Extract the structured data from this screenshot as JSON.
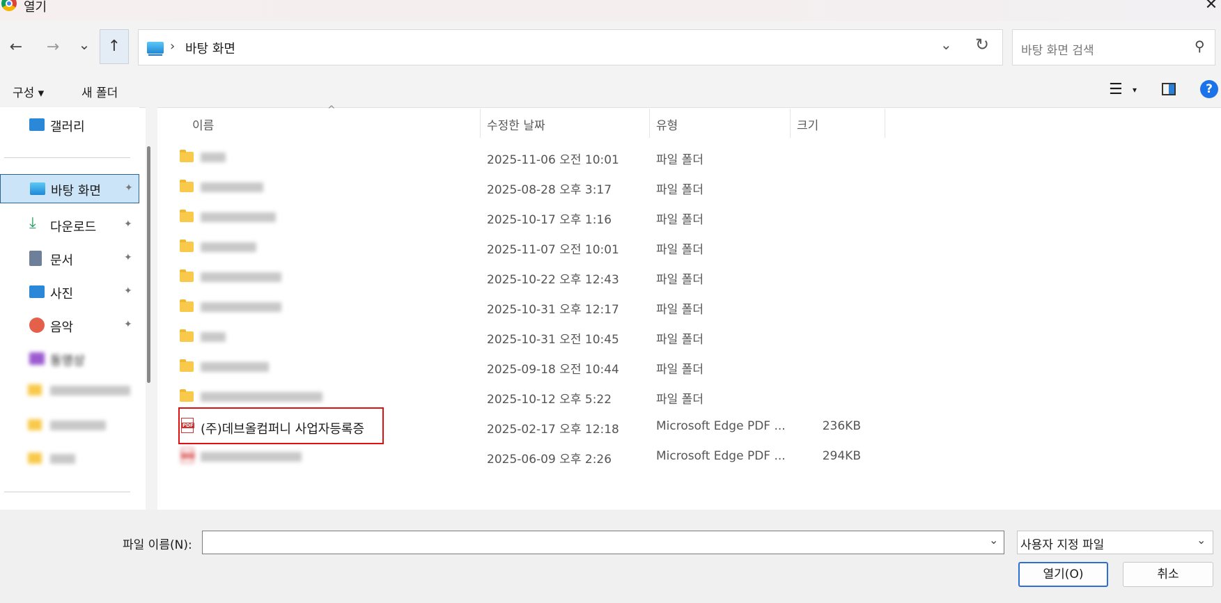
{
  "window": {
    "title": "열기",
    "close_glyph": "✕",
    "app_icon": "chrome-icon"
  },
  "nav": {
    "back_glyph": "←",
    "forward_glyph": "→",
    "recent_glyph": "⌄",
    "up_glyph": "↑",
    "breadcrumb_sep": "›",
    "location": "바탕 화면",
    "address_dropdown_glyph": "⌄",
    "refresh_glyph": "↻",
    "search_placeholder": "바탕 화면 검색",
    "search_glyph": "⚲"
  },
  "toolbar": {
    "organize_label": "구성 ▾",
    "new_folder_label": "새 폴더",
    "view_glyph": "☰",
    "view_dd_glyph": "▾",
    "help_glyph": "?"
  },
  "sidebar": {
    "items": [
      {
        "label": "갤러리",
        "icon": "gallery-icon",
        "color": "#2b88d8"
      },
      {
        "label": "바탕 화면",
        "icon": "desktop-icon",
        "color": "#2aa7e8",
        "selected": true
      },
      {
        "label": "다운로드",
        "icon": "download-icon",
        "color": "#1e9c5a"
      },
      {
        "label": "문서",
        "icon": "document-icon",
        "color": "#6d7f99"
      },
      {
        "label": "사진",
        "icon": "photo-icon",
        "color": "#2b88d8"
      },
      {
        "label": "음악",
        "icon": "music-icon",
        "color": "#e5604a"
      },
      {
        "label": "동영상",
        "icon": "video-icon",
        "color": "#9b5bd0"
      }
    ],
    "pin_glyph": "📌"
  },
  "columns": {
    "name": "이름",
    "modified": "수정한 날짜",
    "type": "유형",
    "size": "크기",
    "sort_glyph": "^"
  },
  "files": [
    {
      "date": "2025-11-06 오전 10:01",
      "type": "파일 폴더",
      "size": ""
    },
    {
      "date": "2025-08-28 오후 3:17",
      "type": "파일 폴더",
      "size": ""
    },
    {
      "date": "2025-10-17 오후 1:16",
      "type": "파일 폴더",
      "size": ""
    },
    {
      "date": "2025-11-07 오전 10:01",
      "type": "파일 폴더",
      "size": ""
    },
    {
      "date": "2025-10-22 오후 12:43",
      "type": "파일 폴더",
      "size": ""
    },
    {
      "date": "2025-10-31 오후 12:17",
      "type": "파일 폴더",
      "size": ""
    },
    {
      "date": "2025-10-31 오전 10:45",
      "type": "파일 폴더",
      "size": ""
    },
    {
      "date": "2025-09-18 오전 10:44",
      "type": "파일 폴더",
      "size": ""
    },
    {
      "date": "2025-10-12 오후 5:22",
      "type": "파일 폴더",
      "size": ""
    },
    {
      "name": "(주)데브올컴퍼니 사업자등록증",
      "date": "2025-02-17 오후 12:18",
      "type": "Microsoft Edge PDF ...",
      "size": "236KB"
    },
    {
      "date": "2025-06-09 오후 2:26",
      "type": "Microsoft Edge PDF ...",
      "size": "294KB"
    }
  ],
  "footer": {
    "filename_label": "파일 이름(N):",
    "filename_value": "",
    "dropdown_glyph": "⌄",
    "filetype_selected": "사용자 지정 파일",
    "open_label": "열기(O)",
    "cancel_label": "취소"
  },
  "colors": {
    "accent": "#2c6ed5",
    "highlight": "#e01010",
    "folder": "#f8c94a",
    "selected_bg": "#cce4f7"
  }
}
